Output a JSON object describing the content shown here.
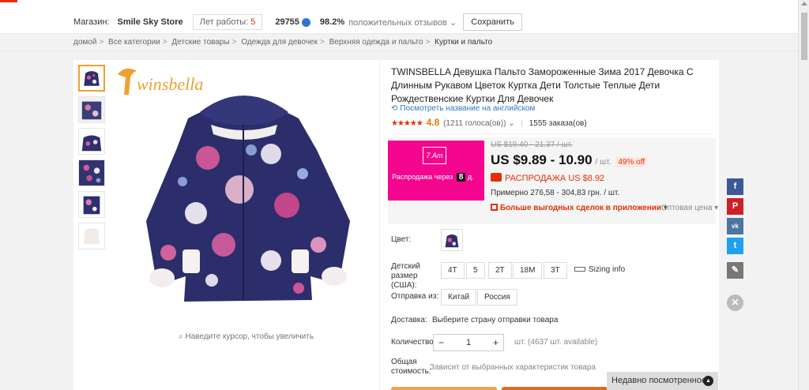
{
  "store": {
    "label": "Магазин:",
    "name": "Smile Sky Store",
    "years_label": "Лет работы:",
    "years_value": "5",
    "feedback_count": "29755",
    "positive_pct": "98.2%",
    "feedback_label": "положительных отзывов",
    "save_label": "Сохранить"
  },
  "breadcrumbs": [
    "домой",
    "Все категории",
    "Детские товары",
    "Одежда для девочек",
    "Верхняя одежда и пальто",
    "Куртки и пальто"
  ],
  "gallery": {
    "brand": "winsbella",
    "zoom_hint": "Наведите курсор, чтобы увеличить"
  },
  "product": {
    "title": "TWINSBELLA Девушка Пальто Замороженные Зима 2017 Девочка С Длинным Рукавом Цветок Куртка Дети Толстые Теплые Дети Рождественские Куртки Для Девочек",
    "translate_link": "Посмотреть название на английском",
    "rating": "4.8",
    "votes": "(1211 голоса(ов))",
    "orders": "1555 заказа(ов)"
  },
  "price": {
    "flash_logo": "7.Am",
    "flash_text": "Распродажа через",
    "flash_days": "8",
    "flash_days_unit": "д.",
    "old": "US $19.40 - 21.37 / шт.",
    "current": "US $9.89 - 10.90",
    "unit": "/ шт.",
    "discount": "49% off",
    "sale_label": "РАСПРОДАЖА",
    "sale_price": "US $8.92",
    "approx": "Примерно 276,58 - 304,83 грн. / шт.",
    "app_deals": "Больше выгодных сделок в приложении",
    "wholesale": "Оптовая цена"
  },
  "options": {
    "color_label": "Цвет:",
    "size_label": "Детский размер (США):",
    "sizes": [
      "4T",
      "5",
      "2T",
      "18M",
      "3T"
    ],
    "sizing_info": "Sizing info",
    "ship_from_label": "Отправка из:",
    "ship_from": [
      "Китай",
      "Россия"
    ],
    "delivery_label": "Доставка:",
    "delivery_value": "Выберите страну отправки товара",
    "qty_label": "Количество:",
    "qty_minus": "−",
    "qty_value": "1",
    "qty_plus": "+",
    "available": "шт. (4637 шт. available)",
    "total_label": "Общая стоимость:",
    "total_value": "Зависит от выбранных характеристик товара"
  },
  "social": [
    "f",
    "P",
    "vk",
    "t"
  ],
  "recent": {
    "label": "Недавно посмотренное"
  },
  "colors": {
    "accent": "#e62e04",
    "link": "#2e77c8",
    "flash": "#f5068f"
  }
}
